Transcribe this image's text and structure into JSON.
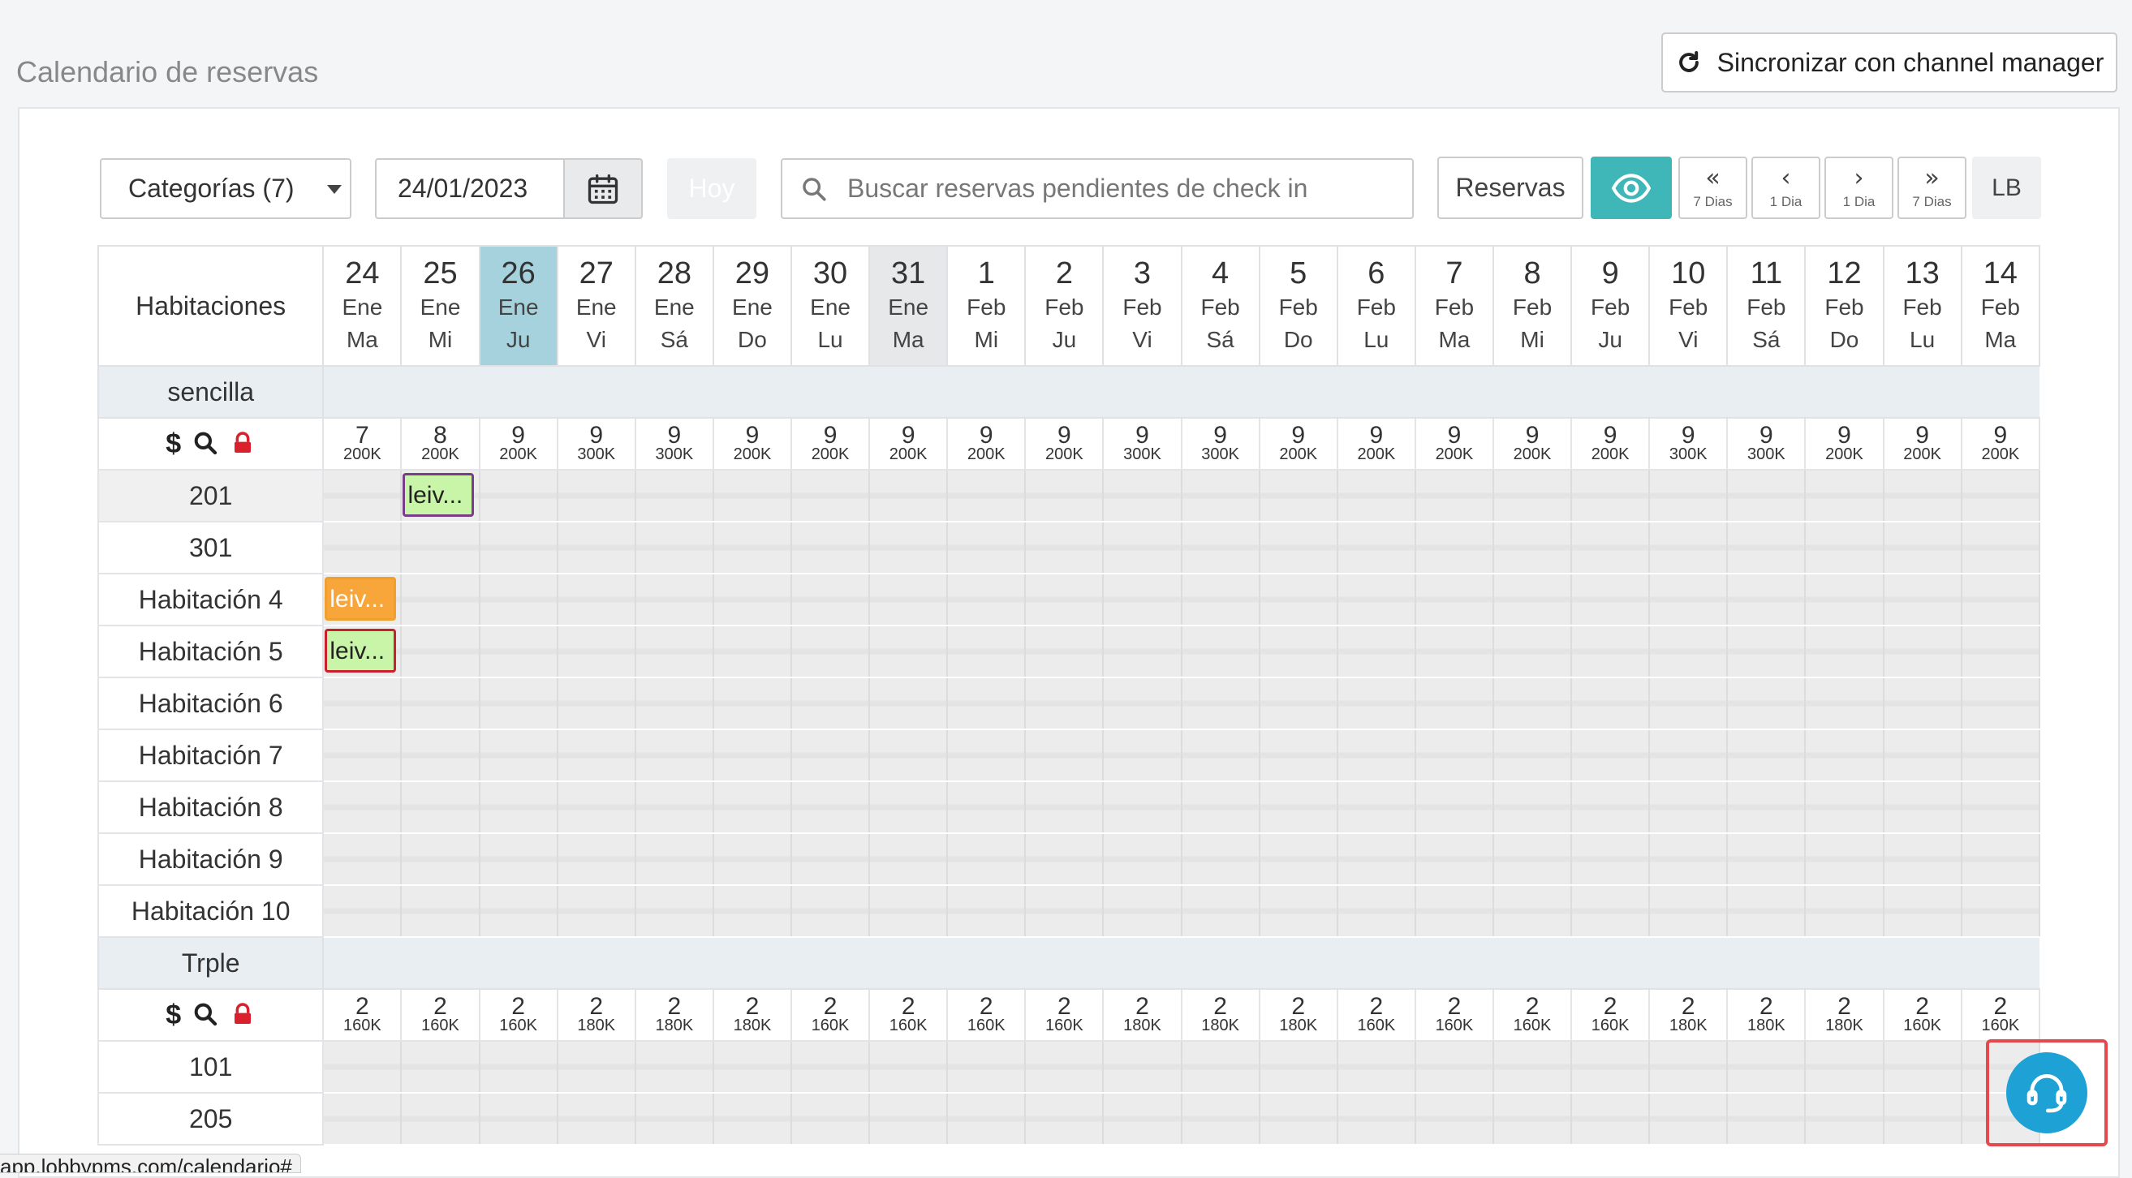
{
  "header": {
    "title": "Calendario de reservas",
    "sync_label": "Sincronizar con channel manager"
  },
  "toolbar": {
    "categories_label": "Categorías (7)",
    "date_value": "24/01/2023",
    "today_label": "Hoy",
    "search_placeholder": "Buscar reservas pendientes de check in",
    "reservations_label": "Reservas",
    "nav": [
      {
        "arrow": "«",
        "label": "7 Dias"
      },
      {
        "arrow": "‹",
        "label": "1 Dia"
      },
      {
        "arrow": "›",
        "label": "1 Dia"
      },
      {
        "arrow": "»",
        "label": "7 Dias"
      }
    ],
    "lb_label": "LB"
  },
  "calendar": {
    "rooms_header": "Habitaciones",
    "days": [
      {
        "day": "24",
        "month": "Ene",
        "weekday": "Ma"
      },
      {
        "day": "25",
        "month": "Ene",
        "weekday": "Mi"
      },
      {
        "day": "26",
        "month": "Ene",
        "weekday": "Ju",
        "today": true
      },
      {
        "day": "27",
        "month": "Ene",
        "weekday": "Vi"
      },
      {
        "day": "28",
        "month": "Ene",
        "weekday": "Sá"
      },
      {
        "day": "29",
        "month": "Ene",
        "weekday": "Do"
      },
      {
        "day": "30",
        "month": "Ene",
        "weekday": "Lu"
      },
      {
        "day": "31",
        "month": "Ene",
        "weekday": "Ma",
        "marked": true
      },
      {
        "day": "1",
        "month": "Feb",
        "weekday": "Mi"
      },
      {
        "day": "2",
        "month": "Feb",
        "weekday": "Ju"
      },
      {
        "day": "3",
        "month": "Feb",
        "weekday": "Vi"
      },
      {
        "day": "4",
        "month": "Feb",
        "weekday": "Sá"
      },
      {
        "day": "5",
        "month": "Feb",
        "weekday": "Do"
      },
      {
        "day": "6",
        "month": "Feb",
        "weekday": "Lu"
      },
      {
        "day": "7",
        "month": "Feb",
        "weekday": "Ma"
      },
      {
        "day": "8",
        "month": "Feb",
        "weekday": "Mi"
      },
      {
        "day": "9",
        "month": "Feb",
        "weekday": "Ju"
      },
      {
        "day": "10",
        "month": "Feb",
        "weekday": "Vi"
      },
      {
        "day": "11",
        "month": "Feb",
        "weekday": "Sá"
      },
      {
        "day": "12",
        "month": "Feb",
        "weekday": "Do"
      },
      {
        "day": "13",
        "month": "Feb",
        "weekday": "Lu"
      },
      {
        "day": "14",
        "month": "Feb",
        "weekday": "Ma"
      }
    ],
    "categories": [
      {
        "name": "sencilla",
        "availability": [
          {
            "n": "7",
            "p": "200K"
          },
          {
            "n": "8",
            "p": "200K"
          },
          {
            "n": "9",
            "p": "200K"
          },
          {
            "n": "9",
            "p": "300K"
          },
          {
            "n": "9",
            "p": "300K"
          },
          {
            "n": "9",
            "p": "200K"
          },
          {
            "n": "9",
            "p": "200K"
          },
          {
            "n": "9",
            "p": "200K"
          },
          {
            "n": "9",
            "p": "200K"
          },
          {
            "n": "9",
            "p": "200K"
          },
          {
            "n": "9",
            "p": "300K"
          },
          {
            "n": "9",
            "p": "300K"
          },
          {
            "n": "9",
            "p": "200K"
          },
          {
            "n": "9",
            "p": "200K"
          },
          {
            "n": "9",
            "p": "200K"
          },
          {
            "n": "9",
            "p": "200K"
          },
          {
            "n": "9",
            "p": "200K"
          },
          {
            "n": "9",
            "p": "300K"
          },
          {
            "n": "9",
            "p": "300K"
          },
          {
            "n": "9",
            "p": "200K"
          },
          {
            "n": "9",
            "p": "200K"
          },
          {
            "n": "9",
            "p": "200K"
          }
        ],
        "rooms": [
          {
            "name": "201",
            "shade": true,
            "reservations": [
              {
                "col": 1,
                "label": "leiv...",
                "style": "green-purple"
              }
            ]
          },
          {
            "name": "301",
            "reservations": []
          },
          {
            "name": "Habitación 4",
            "reservations": [
              {
                "col": 0,
                "label": "leiv...",
                "style": "orange"
              }
            ]
          },
          {
            "name": "Habitación 5",
            "reservations": [
              {
                "col": 0,
                "label": "leiv...",
                "style": "green-red"
              }
            ]
          },
          {
            "name": "Habitación 6",
            "reservations": []
          },
          {
            "name": "Habitación 7",
            "reservations": []
          },
          {
            "name": "Habitación 8",
            "reservations": []
          },
          {
            "name": "Habitación 9",
            "reservations": []
          },
          {
            "name": "Habitación 10",
            "reservations": []
          }
        ]
      },
      {
        "name": "Trple",
        "availability": [
          {
            "n": "2",
            "p": "160K"
          },
          {
            "n": "2",
            "p": "160K"
          },
          {
            "n": "2",
            "p": "160K"
          },
          {
            "n": "2",
            "p": "180K"
          },
          {
            "n": "2",
            "p": "180K"
          },
          {
            "n": "2",
            "p": "180K"
          },
          {
            "n": "2",
            "p": "160K"
          },
          {
            "n": "2",
            "p": "160K"
          },
          {
            "n": "2",
            "p": "160K"
          },
          {
            "n": "2",
            "p": "160K"
          },
          {
            "n": "2",
            "p": "180K"
          },
          {
            "n": "2",
            "p": "180K"
          },
          {
            "n": "2",
            "p": "180K"
          },
          {
            "n": "2",
            "p": "160K"
          },
          {
            "n": "2",
            "p": "160K"
          },
          {
            "n": "2",
            "p": "160K"
          },
          {
            "n": "2",
            "p": "160K"
          },
          {
            "n": "2",
            "p": "180K"
          },
          {
            "n": "2",
            "p": "180K"
          },
          {
            "n": "2",
            "p": "180K"
          },
          {
            "n": "2",
            "p": "160K"
          },
          {
            "n": "2",
            "p": "160K"
          }
        ],
        "rooms": [
          {
            "name": "101",
            "reservations": []
          },
          {
            "name": "205",
            "reservations": []
          }
        ]
      }
    ]
  },
  "status_url": "app.lobbypms.com/calendario#",
  "colors": {
    "accent": "#3fb6b8",
    "today_header": "#a6d2dd",
    "today_line": "#e05060",
    "help_button": "#1ea2d6",
    "lock_icon": "#d9202c"
  }
}
